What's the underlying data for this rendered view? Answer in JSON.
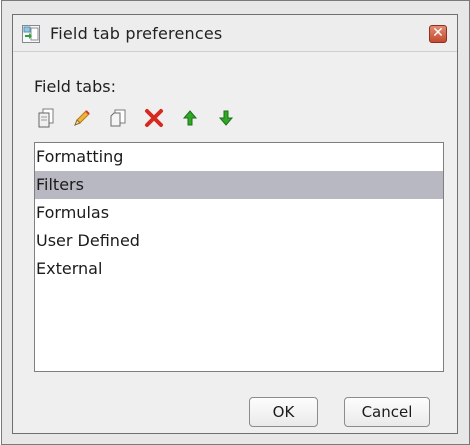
{
  "window": {
    "title": "Field tab preferences",
    "close_symbol": "✕"
  },
  "section": {
    "label": "Field tabs:"
  },
  "toolbar": {
    "tools": [
      {
        "name": "copy",
        "icon": "copy-icon"
      },
      {
        "name": "rename",
        "icon": "pencil-icon"
      },
      {
        "name": "duplicate",
        "icon": "duplicate-icon"
      },
      {
        "name": "delete",
        "icon": "delete-icon"
      },
      {
        "name": "move-up",
        "icon": "arrow-up-icon"
      },
      {
        "name": "move-down",
        "icon": "arrow-down-icon"
      }
    ]
  },
  "list": {
    "items": [
      {
        "label": "Formatting",
        "selected": false
      },
      {
        "label": "Filters",
        "selected": true
      },
      {
        "label": "Formulas",
        "selected": false
      },
      {
        "label": "User Defined",
        "selected": false
      },
      {
        "label": "External",
        "selected": false
      }
    ]
  },
  "buttons": {
    "ok": "OK",
    "cancel": "Cancel"
  },
  "colors": {
    "selected_row": "#b8b8c3",
    "delete_red": "#d62a1f",
    "arrow_green": "#2fa826"
  }
}
